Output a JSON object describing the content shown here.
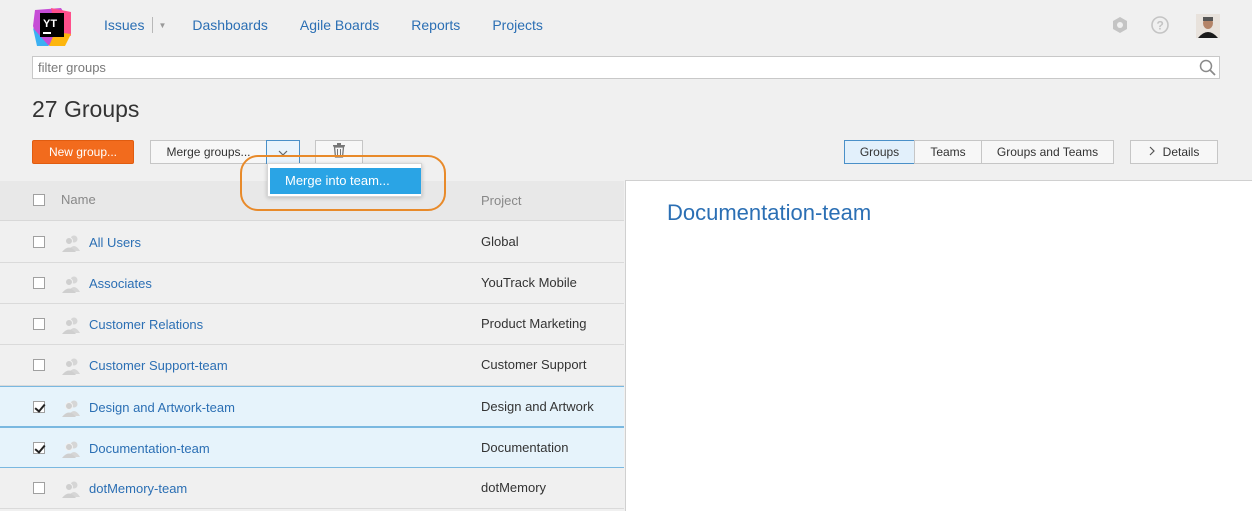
{
  "header": {
    "logo_text": "YT",
    "nav": [
      {
        "label": "Issues"
      },
      {
        "label": "Dashboards"
      },
      {
        "label": "Agile Boards"
      },
      {
        "label": "Reports"
      },
      {
        "label": "Projects"
      }
    ],
    "icons": [
      "settings-icon",
      "help-icon",
      "avatar"
    ]
  },
  "search": {
    "placeholder": "filter groups"
  },
  "page_title": "27 Groups",
  "toolbar": {
    "new_group": "New group...",
    "merge_groups": "Merge groups...",
    "merge_into_team": "Merge into team...",
    "view_tabs": [
      {
        "label": "Groups",
        "active": true
      },
      {
        "label": "Teams",
        "active": false
      },
      {
        "label": "Groups and Teams",
        "active": false
      }
    ],
    "details": "Details"
  },
  "table": {
    "columns": [
      "Name",
      "Project"
    ],
    "rows": [
      {
        "name": "All Users",
        "project": "Global",
        "checked": false
      },
      {
        "name": "Associates",
        "project": "YouTrack Mobile",
        "checked": false
      },
      {
        "name": "Customer Relations",
        "project": "Product Marketing",
        "checked": false
      },
      {
        "name": "Customer Support-team",
        "project": "Customer Support",
        "checked": false
      },
      {
        "name": "Design and Artwork-team",
        "project": "Design and Artwork",
        "checked": true
      },
      {
        "name": "Documentation-team",
        "project": "Documentation",
        "checked": true
      },
      {
        "name": "dotMemory-team",
        "project": "dotMemory",
        "checked": false
      }
    ]
  },
  "details_panel": {
    "title": "Documentation-team"
  },
  "colors": {
    "accent": "#2b6fb4",
    "primary_button": "#f26b1d",
    "menu_highlight": "#2aa4e5",
    "annotation_ring": "#e88a2a"
  }
}
